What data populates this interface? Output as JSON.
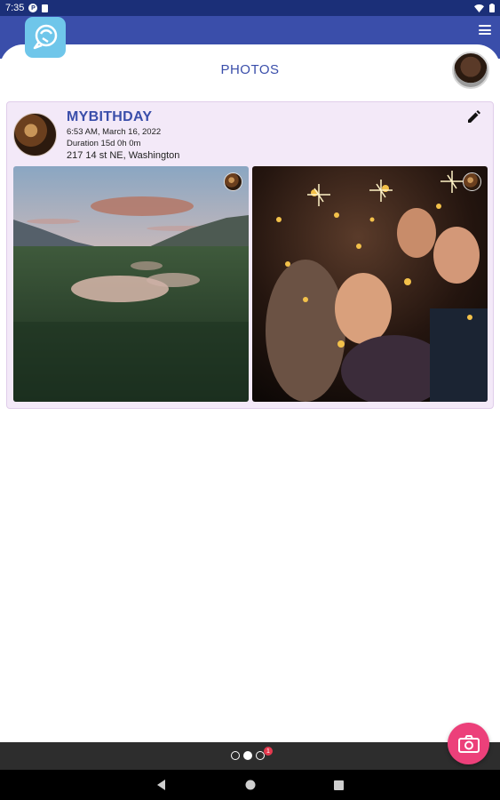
{
  "status_bar": {
    "time": "7:35",
    "icon_letter": "P"
  },
  "header": {
    "title": "PHOTOS"
  },
  "event": {
    "title": "MYBITHDAY",
    "time": "6:53 AM, March 16, 2022",
    "duration": "Duration 15d 0h 0m",
    "location": "217 14 st NE, Washington"
  },
  "pager": {
    "badge": "1"
  },
  "colors": {
    "header": "#3a4eaa",
    "status": "#1b2f78",
    "card": "#f3e9f8",
    "fab": "#ec407a",
    "logo": "#6fc6ea"
  },
  "icons": [
    "wifi-icon",
    "battery-icon",
    "menu-icon",
    "edit-icon",
    "camera-icon",
    "back-icon",
    "home-icon",
    "recents-icon"
  ]
}
